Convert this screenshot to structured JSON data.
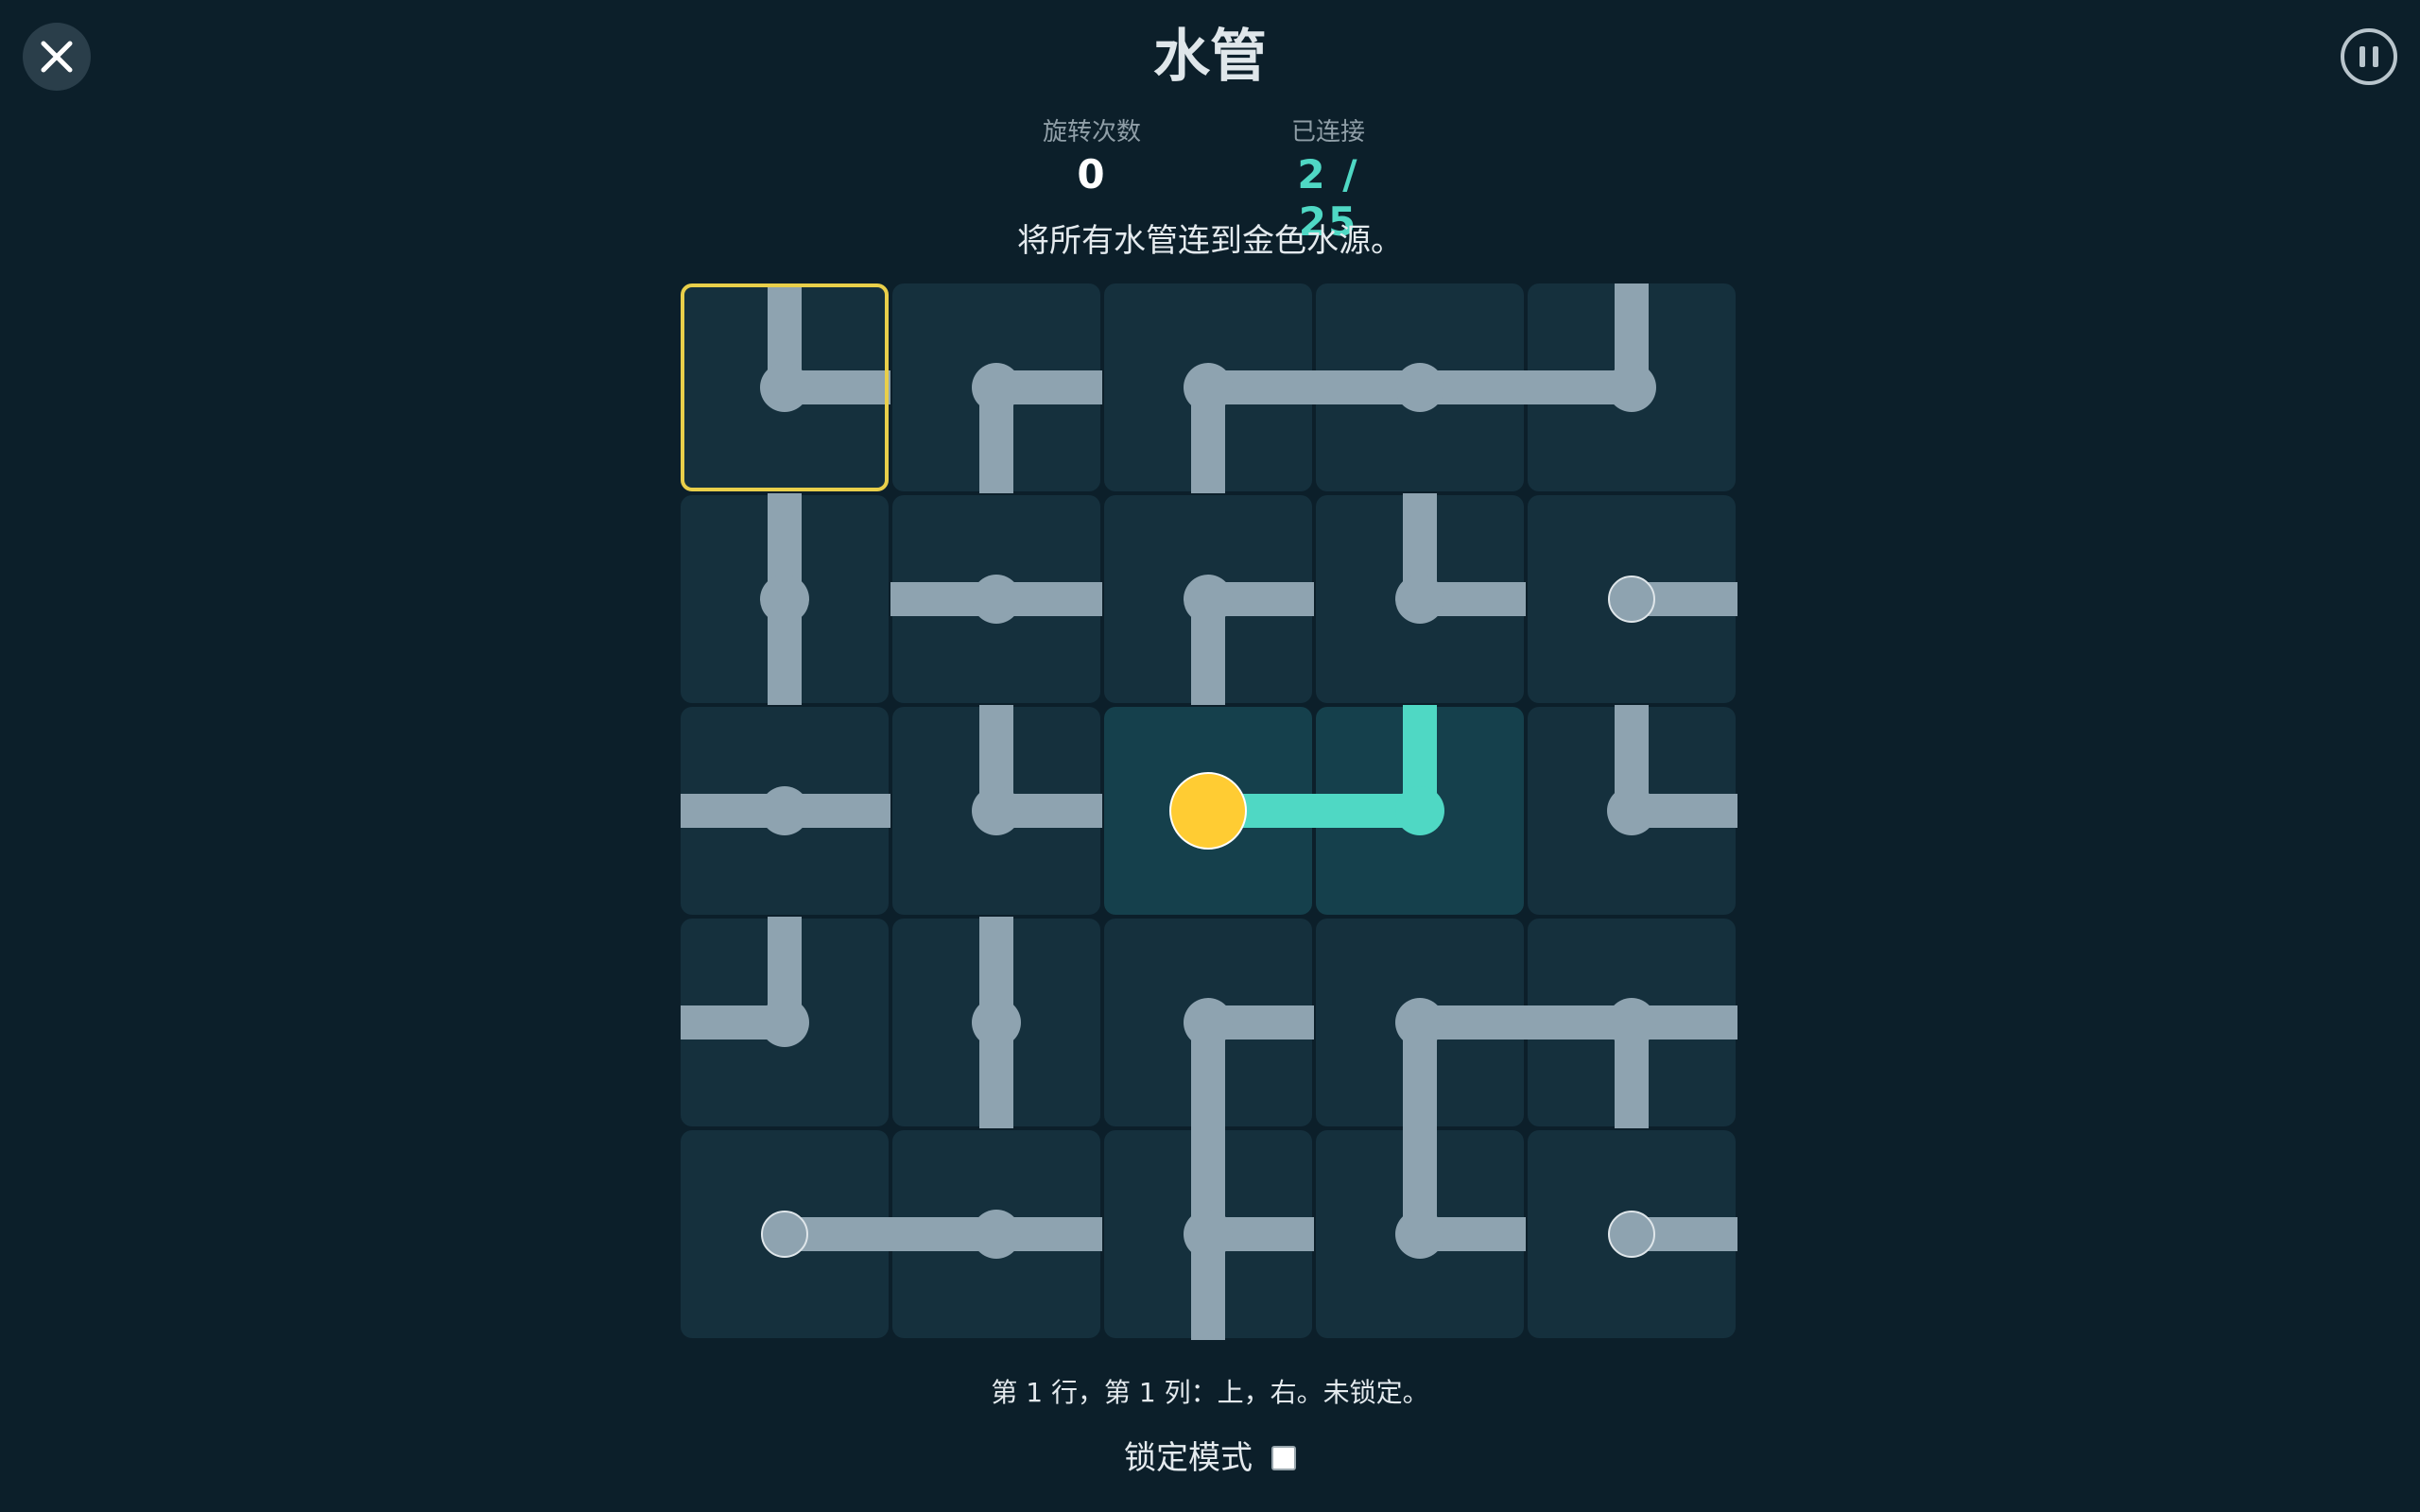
{
  "header": {
    "title": "水管",
    "close_icon": "close-icon",
    "pause_icon": "pause-icon"
  },
  "stats": {
    "rotations_label": "旋转次数",
    "rotations_value": "0",
    "connected_label": "已连接",
    "connected_value": "2 / 25"
  },
  "instruction": "将所有水管连到金色水源。",
  "status": "第 1 行，第 1 列：上，右。未锁定。",
  "lock_mode": {
    "label": "锁定模式",
    "checked": false
  },
  "colors": {
    "background": "#0c1f2a",
    "tile": "#15303d",
    "tile_connected": "#15404c",
    "pipe": "#8ea3b0",
    "pipe_connected": "#4fd8c4",
    "source": "#ffcc33",
    "selection": "#e9cf4a"
  },
  "grid": {
    "rows": 5,
    "cols": 5,
    "selected": [
      0,
      0
    ],
    "source": [
      2,
      2
    ],
    "tiles": [
      [
        {
          "dirs": [
            "up",
            "right"
          ],
          "connected": false
        },
        {
          "dirs": [
            "right",
            "down"
          ],
          "connected": false
        },
        {
          "dirs": [
            "right",
            "down"
          ],
          "connected": false
        },
        {
          "dirs": [
            "left",
            "right"
          ],
          "connected": false
        },
        {
          "dirs": [
            "left",
            "up"
          ],
          "connected": false
        }
      ],
      [
        {
          "dirs": [
            "up",
            "down"
          ],
          "connected": false
        },
        {
          "dirs": [
            "left",
            "right"
          ],
          "connected": false
        },
        {
          "dirs": [
            "right",
            "down"
          ],
          "connected": false
        },
        {
          "dirs": [
            "up",
            "right"
          ],
          "connected": false
        },
        {
          "dirs": [
            "right"
          ],
          "connected": false
        }
      ],
      [
        {
          "dirs": [
            "left",
            "right"
          ],
          "connected": false
        },
        {
          "dirs": [
            "up",
            "right"
          ],
          "connected": false
        },
        {
          "dirs": [
            "right"
          ],
          "connected": true
        },
        {
          "dirs": [
            "left",
            "up"
          ],
          "connected": true
        },
        {
          "dirs": [
            "up",
            "right"
          ],
          "connected": false
        }
      ],
      [
        {
          "dirs": [
            "left",
            "up"
          ],
          "connected": false
        },
        {
          "dirs": [
            "up",
            "down"
          ],
          "connected": false
        },
        {
          "dirs": [
            "right",
            "down"
          ],
          "connected": false
        },
        {
          "dirs": [
            "right",
            "down"
          ],
          "connected": false
        },
        {
          "dirs": [
            "left",
            "right",
            "down"
          ],
          "connected": false
        }
      ],
      [
        {
          "dirs": [
            "right"
          ],
          "connected": false
        },
        {
          "dirs": [
            "left",
            "right"
          ],
          "connected": false
        },
        {
          "dirs": [
            "up",
            "right",
            "down"
          ],
          "connected": false
        },
        {
          "dirs": [
            "up",
            "right"
          ],
          "connected": false
        },
        {
          "dirs": [
            "right"
          ],
          "connected": false
        }
      ]
    ]
  }
}
